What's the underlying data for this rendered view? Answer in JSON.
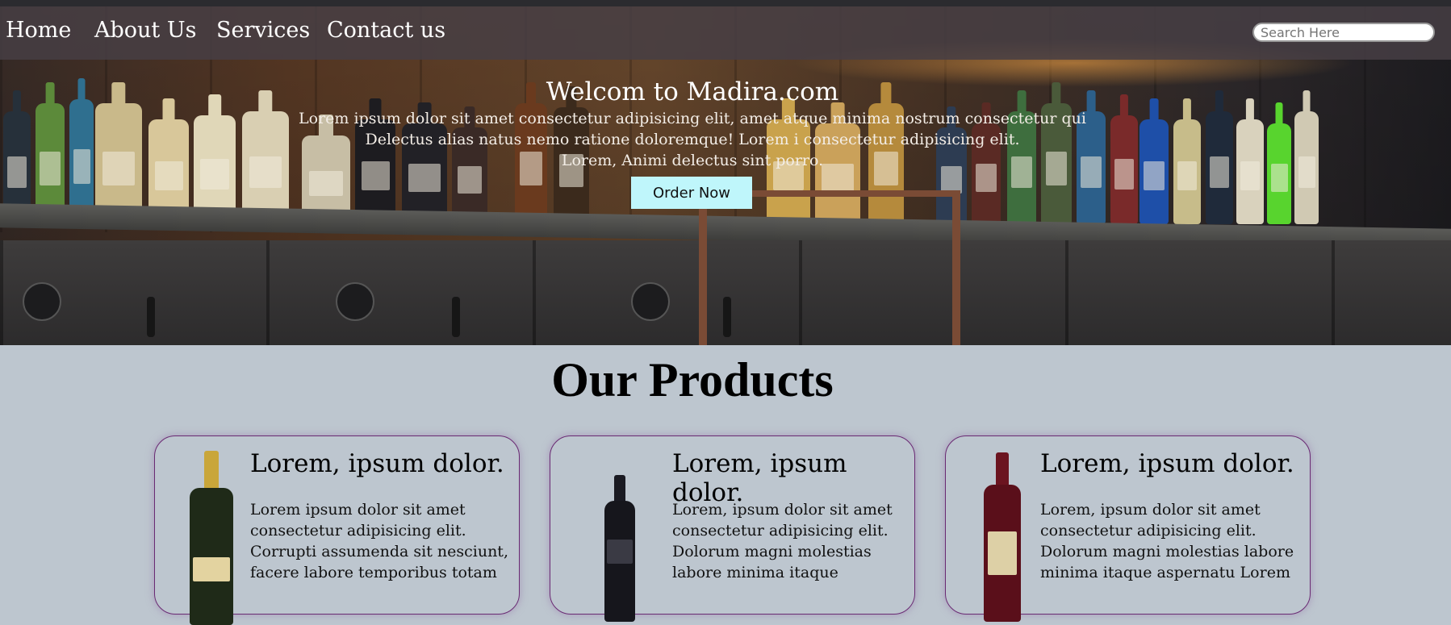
{
  "nav": {
    "items": [
      {
        "label": "Home"
      },
      {
        "label": "About Us"
      },
      {
        "label": "Services"
      },
      {
        "label": "Contact us"
      }
    ],
    "search_placeholder": "Search Here"
  },
  "hero": {
    "title": "Welcom to Madira.com",
    "lines": [
      "Lorem ipsum dolor sit amet consectetur adipisicing elit, amet atque minima nostrum consectetur qui",
      "Delectus alias natus nemo ratione doloremque! Lorem i consectetur adipisicing elit.",
      "Lorem, Animi delectus sint porro."
    ],
    "button_label": "Order Now"
  },
  "products": {
    "title": "Our Products",
    "cards": [
      {
        "title": "Lorem, ipsum dolor.",
        "text": "Lorem ipsum dolor sit amet consectetur adipisicing elit. Corrupti assumenda sit nesciunt, facere labore temporibus totam"
      },
      {
        "title": "Lorem, ipsum dolor.",
        "text": "Lorem, ipsum dolor sit amet consectetur adipisicing elit. Dolorum magni molestias labore minima itaque"
      },
      {
        "title": "Lorem, ipsum dolor.",
        "text": "Lorem, ipsum dolor sit amet consectetur adipisicing elit. Dolorum magni molestias labore minima itaque aspernatu Lorem"
      }
    ]
  },
  "colors": {
    "page_bg": "#bdc6cf",
    "nav_bg": "#463e44",
    "button_bg": "#bff6fb",
    "card_border": "#6a2a73"
  }
}
